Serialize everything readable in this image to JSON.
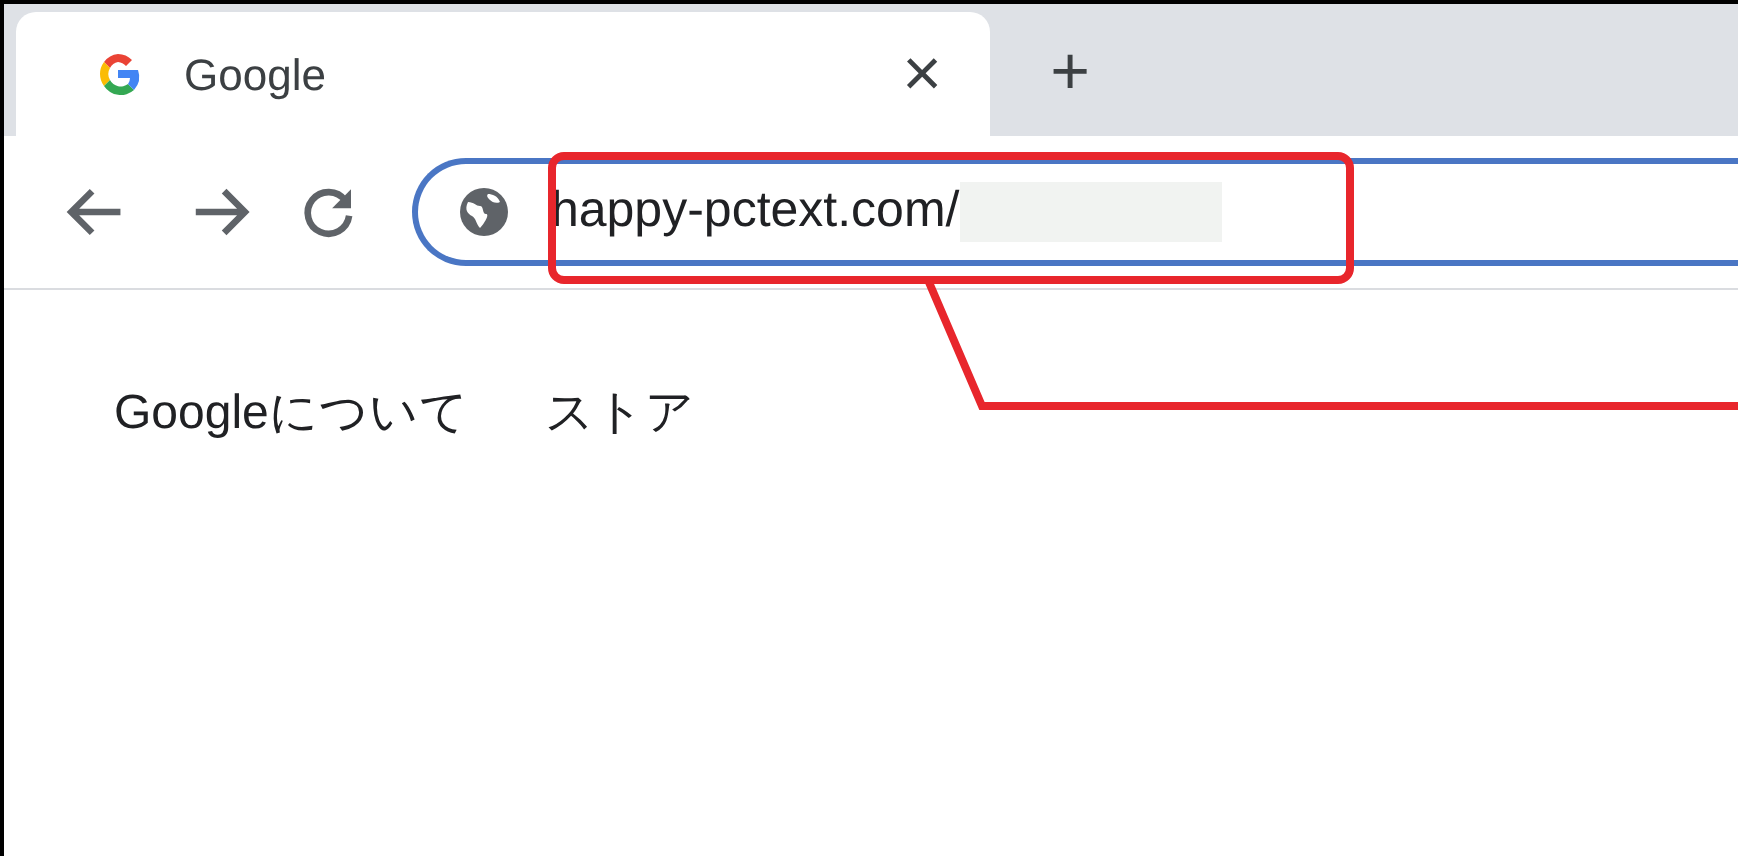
{
  "tabs": [
    {
      "title": "Google",
      "close": "×",
      "selected": true
    }
  ],
  "new_tab": "+",
  "address_bar": {
    "value": "happy-pctext.com/"
  },
  "page_links": [
    "Googleについて",
    "ストア"
  ]
}
